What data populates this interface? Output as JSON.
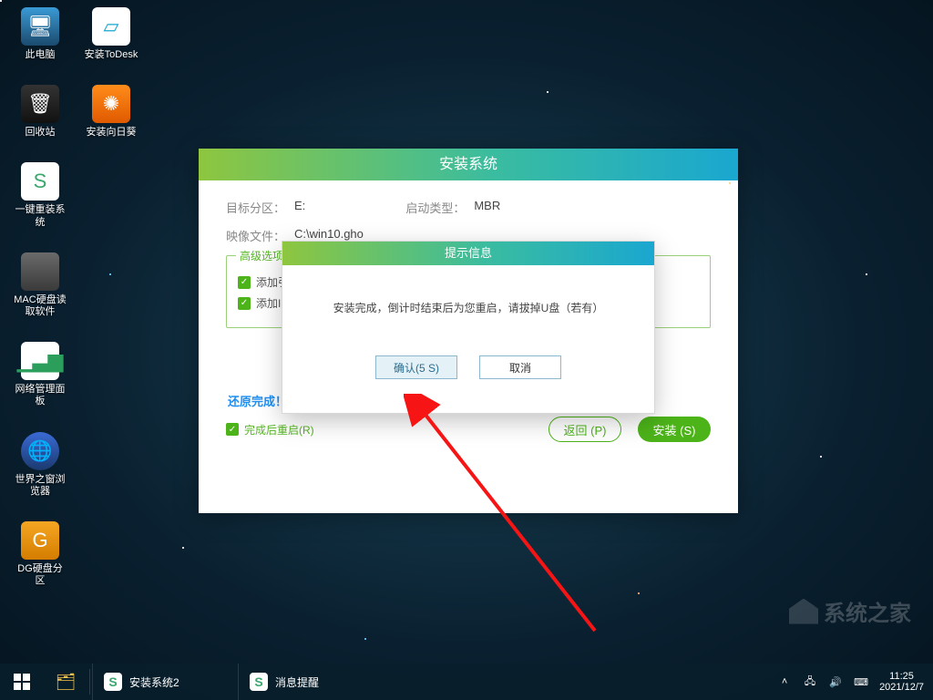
{
  "desktop": {
    "icons_col1": [
      {
        "label": "此电脑"
      },
      {
        "label": "回收站"
      },
      {
        "label": "一键重装系统"
      },
      {
        "label": "MAC硬盘读取软件"
      },
      {
        "label": "网络管理面板"
      },
      {
        "label": "世界之窗浏览器"
      },
      {
        "label": "DG硬盘分区"
      }
    ],
    "icons_col2": [
      {
        "label": "安装ToDesk"
      },
      {
        "label": "安装向日葵"
      }
    ]
  },
  "installer": {
    "title": "安装系统",
    "target_label": "目标分区：",
    "target_value": "E:",
    "boot_label": "启动类型：",
    "boot_value": "MBR",
    "image_label": "映像文件：",
    "image_value": "C:\\win10.gho",
    "adv_legend": "高级选项",
    "chk1": "添加引",
    "chk2": "添加I",
    "restore_done": "还原完成！",
    "reboot_chk": "完成后重启(R)",
    "btn_back": "返回 (P)",
    "btn_install": "安装 (S)"
  },
  "modal": {
    "title": "提示信息",
    "message": "安装完成，倒计时结束后为您重启，请拔掉U盘（若有）",
    "confirm": "确认(5 S)",
    "cancel": "取消"
  },
  "taskbar": {
    "items": [
      {
        "label": "安装系统2"
      },
      {
        "label": "消息提醒"
      }
    ],
    "time": "11:25",
    "date": "2021/12/7"
  },
  "watermark": "系统之家"
}
